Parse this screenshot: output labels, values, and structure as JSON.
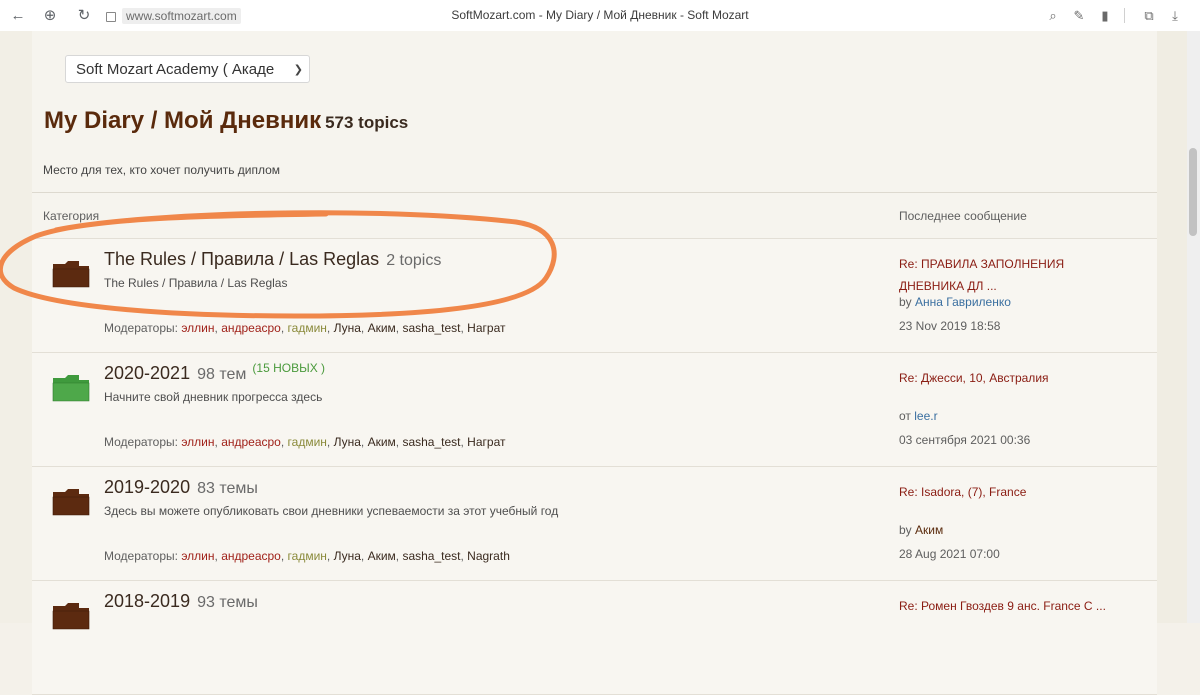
{
  "browser": {
    "url": "www.softmozart.com",
    "tab_title": "SoftMozart.com - My Diary / Мой Дневник - Soft Mozart"
  },
  "forum": {
    "selector_value": "Soft Mozart Academy ( Акаде",
    "title": "My Diary / Мой Дневник",
    "topic_count": "573 topics",
    "description": "Место для тех, кто хочет получить диплом",
    "col_category": "Категория",
    "col_last_post": "Последнее сообщение"
  },
  "colors": {
    "accent": "#5a2a0c",
    "folder_brown": "#5c2a10",
    "folder_green": "#4ea84a",
    "annotation": "#f0874a"
  },
  "rows": [
    {
      "title": "The Rules / Правила / Las Reglas",
      "topics": "2 topics",
      "new_badge": "",
      "description": "The Rules / Правила / Las Reglas",
      "folder_icon": "folder-brown-icon",
      "mods_label": "Модераторы:",
      "mods": [
        "эллин",
        "андреасро",
        "гадмин",
        "Луна",
        "Аким",
        "sasha_test",
        "Награт"
      ],
      "last_title": "Re: ПРАВИЛА ЗАПОЛНЕНИЯ ДНЕВНИКА ДЛ ...",
      "last_by_prefix": "by",
      "last_by_user": "Анна Гавриленко",
      "last_date": "23 Nov 2019 18:58"
    },
    {
      "title": "2020-2021",
      "topics": "98 тем",
      "new_badge": "(15 НОВЫХ )",
      "description": "Начните свой дневник прогресса здесь",
      "folder_icon": "folder-green-icon",
      "mods_label": "Модераторы:",
      "mods": [
        "эллин",
        "андреасро",
        "гадмин",
        "Луна",
        "Аким",
        "sasha_test",
        "Награт"
      ],
      "last_title": "Re: Джесси, 10, Австралия",
      "last_by_prefix": "от",
      "last_by_user": "lee.r",
      "last_date": "03 сентября 2021 00:36"
    },
    {
      "title": "2019-2020",
      "topics": "83 темы",
      "new_badge": "",
      "description": "Здесь вы можете опубликовать свои дневники успеваемости за этот учебный год",
      "folder_icon": "folder-brown-icon",
      "mods_label": "Модераторы:",
      "mods": [
        "эллин",
        "андреасро",
        "гадмин",
        "Луна",
        "Аким",
        "sasha_test",
        "Nagrath"
      ],
      "last_title": "Re: Isadora, (7), France",
      "last_by_prefix": "by",
      "last_by_user": "Аким",
      "last_date": "28 Aug 2021 07:00"
    },
    {
      "title": "2018-2019",
      "topics": "93 темы",
      "new_badge": "",
      "description": "",
      "folder_icon": "folder-brown-icon",
      "mods_label": "",
      "mods": [],
      "last_title": "Re: Ромен Гвоздев 9 анс. France C ...",
      "last_by_prefix": "",
      "last_by_user": "",
      "last_date": ""
    }
  ]
}
